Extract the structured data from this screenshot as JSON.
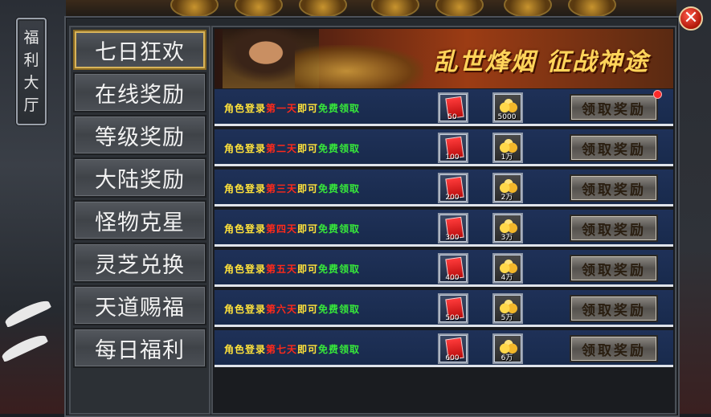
{
  "side_tab": {
    "chars": [
      "福",
      "利",
      "大",
      "厅"
    ]
  },
  "nav": {
    "items": [
      {
        "label": "七日狂欢",
        "active": true
      },
      {
        "label": "在线奖励",
        "active": false
      },
      {
        "label": "等级奖励",
        "active": false
      },
      {
        "label": "大陆奖励",
        "active": false
      },
      {
        "label": "怪物克星",
        "active": false
      },
      {
        "label": "灵芝兑换",
        "active": false
      },
      {
        "label": "天道赐福",
        "active": false
      },
      {
        "label": "每日福利",
        "active": false
      }
    ]
  },
  "banner": {
    "slogan": "乱世烽烟 征战神途"
  },
  "rewards": {
    "claim_label": "领取奖励",
    "rows": [
      {
        "prefix": "角色登录",
        "day": "第一天",
        "mid": "即可",
        "free": "免费领取",
        "bag_qty": "50",
        "gold_qty": "5000",
        "notify": true
      },
      {
        "prefix": "角色登录",
        "day": "第二天",
        "mid": "即可",
        "free": "免费领取",
        "bag_qty": "100",
        "gold_qty": "1万",
        "notify": false
      },
      {
        "prefix": "角色登录",
        "day": "第三天",
        "mid": "即可",
        "free": "免费领取",
        "bag_qty": "200",
        "gold_qty": "2万",
        "notify": false
      },
      {
        "prefix": "角色登录",
        "day": "第四天",
        "mid": "即可",
        "free": "免费领取",
        "bag_qty": "300",
        "gold_qty": "3万",
        "notify": false
      },
      {
        "prefix": "角色登录",
        "day": "第五天",
        "mid": "即可",
        "free": "免费领取",
        "bag_qty": "400",
        "gold_qty": "4万",
        "notify": false
      },
      {
        "prefix": "角色登录",
        "day": "第六天",
        "mid": "即可",
        "free": "免费领取",
        "bag_qty": "500",
        "gold_qty": "5万",
        "notify": false
      },
      {
        "prefix": "角色登录",
        "day": "第七天",
        "mid": "即可",
        "free": "免费领取",
        "bag_qty": "600",
        "gold_qty": "6万",
        "notify": false
      }
    ]
  },
  "icons": {
    "close": "close-icon",
    "bag": "red-envelope-icon",
    "gold": "gold-coins-icon"
  },
  "colors": {
    "text_yellow": "#ffe23a",
    "text_red": "#ff2a1a",
    "text_green": "#37e83a",
    "row_bg": "#1f3158"
  }
}
